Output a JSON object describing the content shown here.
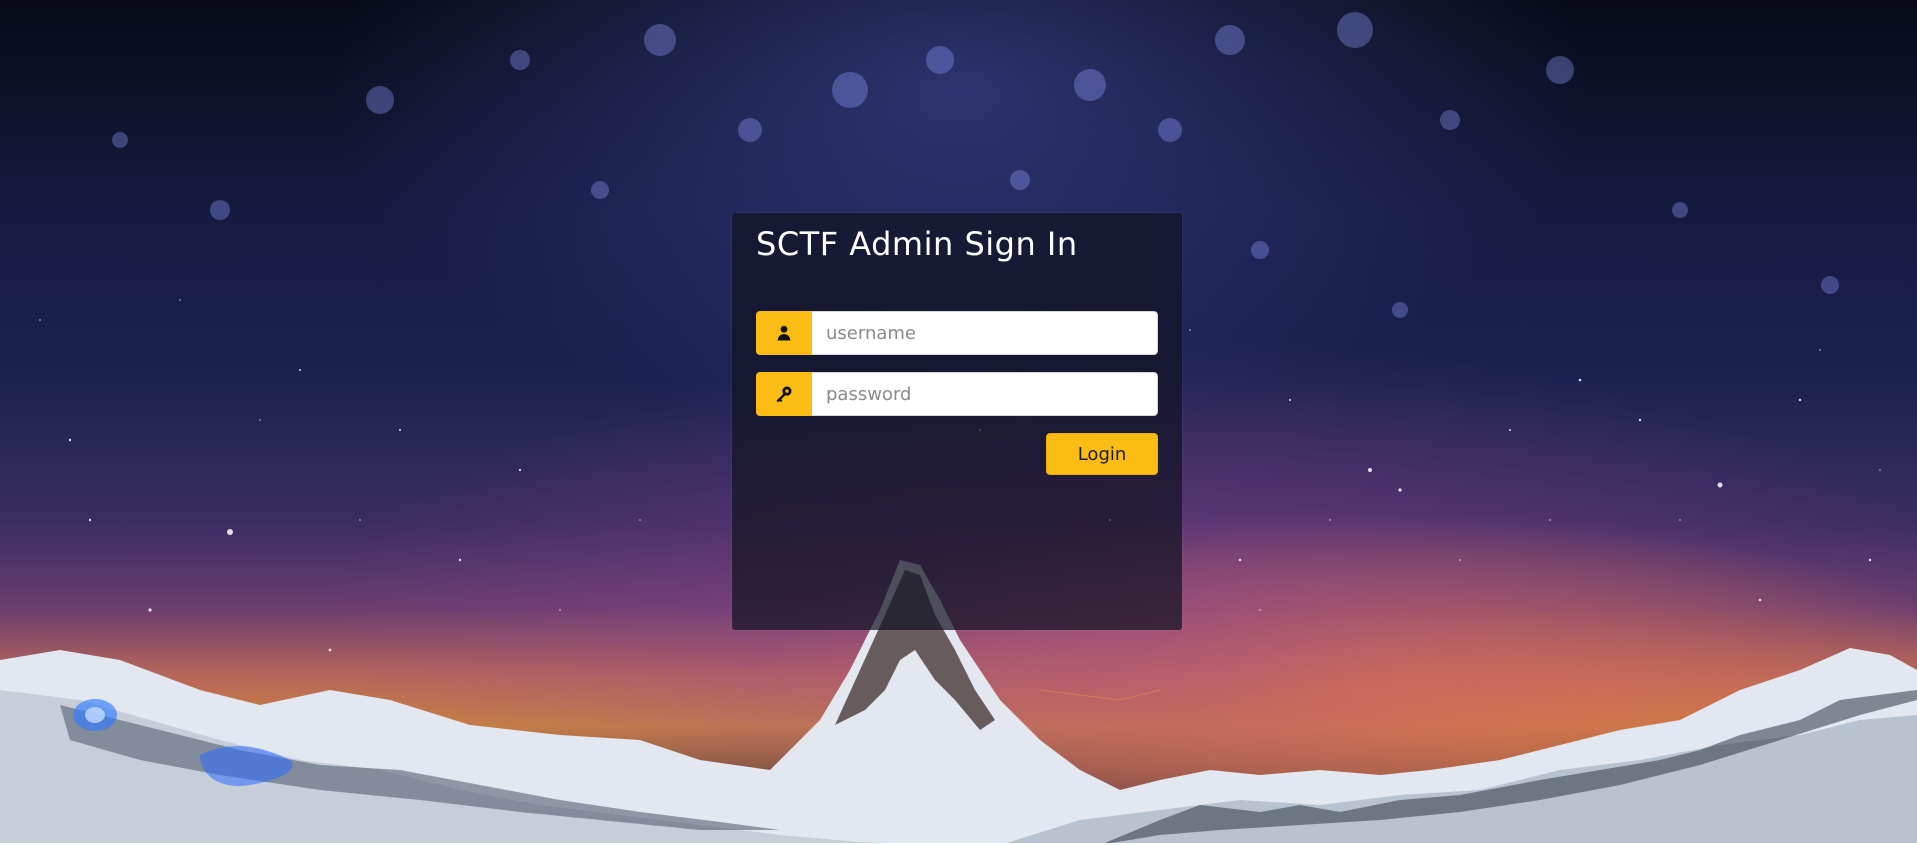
{
  "page": {
    "title": "SCTF Admin Sign In"
  },
  "form": {
    "username": {
      "placeholder": "username",
      "value": "",
      "icon": "user-icon"
    },
    "password": {
      "placeholder": "password",
      "value": "",
      "icon": "key-icon"
    },
    "login_label": "Login"
  },
  "colors": {
    "accent": "#fbbd14",
    "panel_bg": "rgba(18,20,34,0.72)",
    "title_text": "#ffffff"
  }
}
